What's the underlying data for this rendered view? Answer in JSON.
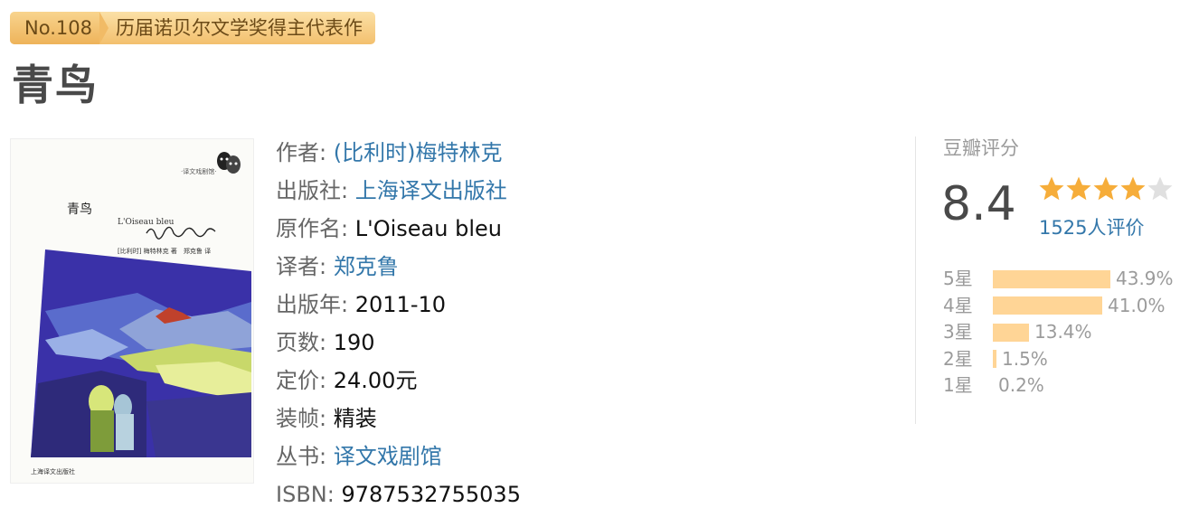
{
  "badge": {
    "number": "No.108",
    "text": "历届诺贝尔文学奖得主代表作"
  },
  "book": {
    "title": "青鸟",
    "cover": {
      "series_mark": "·译文戏剧馆·",
      "title": "青鸟",
      "subtitle": "L'Oiseau bleu",
      "credit": "[比利时] 梅特林克 著　郑克鲁 译",
      "publisher": "上海译文出版社"
    },
    "info": [
      {
        "label": "作者:",
        "value": "(比利时)梅特林克",
        "link": true
      },
      {
        "label": "出版社:",
        "value": "上海译文出版社",
        "link": true
      },
      {
        "label": "原作名:",
        "value": "L'Oiseau bleu",
        "link": false
      },
      {
        "label": "译者:",
        "value": "郑克鲁",
        "link": true
      },
      {
        "label": "出版年:",
        "value": "2011-10",
        "link": false
      },
      {
        "label": "页数:",
        "value": "190",
        "link": false
      },
      {
        "label": "定价:",
        "value": "24.00元",
        "link": false
      },
      {
        "label": "装帧:",
        "value": "精装",
        "link": false
      },
      {
        "label": "丛书:",
        "value": "译文戏剧馆",
        "link": true
      },
      {
        "label": "ISBN:",
        "value": "9787532755035",
        "link": false
      }
    ]
  },
  "rating": {
    "title": "豆瓣评分",
    "score": "8.4",
    "stars_filled": 4,
    "stars_total": 5,
    "votes": "1525人评价",
    "distribution": [
      {
        "label": "5星",
        "percent": "43.9%",
        "value": 43.9
      },
      {
        "label": "4星",
        "percent": "41.0%",
        "value": 41.0
      },
      {
        "label": "3星",
        "percent": "13.4%",
        "value": 13.4
      },
      {
        "label": "2星",
        "percent": "1.5%",
        "value": 1.5
      },
      {
        "label": "1星",
        "percent": "0.2%",
        "value": 0.2
      }
    ]
  },
  "colors": {
    "link": "#3377aa",
    "bar": "#ffd596",
    "star": "#f6ad3a",
    "star_empty": "#e0e0e0"
  }
}
